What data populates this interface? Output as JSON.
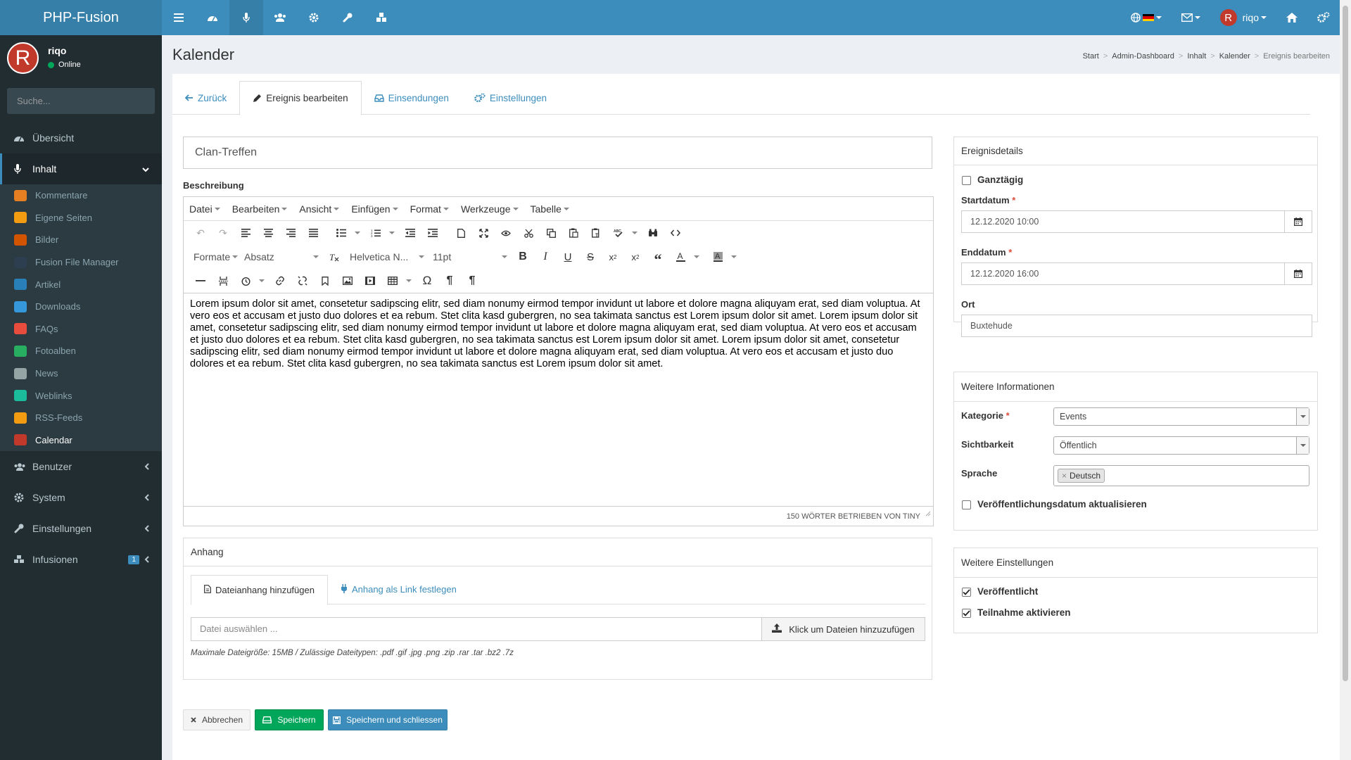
{
  "brand": "PHP-Fusion",
  "topbar": {
    "user_name": "riqo",
    "user_initial": "R"
  },
  "sidebar": {
    "user_name": "riqo",
    "user_initial": "R",
    "status": "Online",
    "search_placeholder": "Suche...",
    "items": {
      "overview": "Übersicht",
      "content": "Inhalt",
      "users": "Benutzer",
      "system": "System",
      "settings": "Einstellungen",
      "infusions": "Infusionen",
      "infusions_badge": "1"
    },
    "subitems": [
      {
        "label": "Kommentare",
        "color": "#e67e22"
      },
      {
        "label": "Eigene Seiten",
        "color": "#f39c12"
      },
      {
        "label": "Bilder",
        "color": "#d35400"
      },
      {
        "label": "Fusion File Manager",
        "color": "#2c3e50"
      },
      {
        "label": "Artikel",
        "color": "#2980b9"
      },
      {
        "label": "Downloads",
        "color": "#3498db"
      },
      {
        "label": "FAQs",
        "color": "#e74c3c"
      },
      {
        "label": "Fotoalben",
        "color": "#27ae60"
      },
      {
        "label": "News",
        "color": "#95a5a6"
      },
      {
        "label": "Weblinks",
        "color": "#1abc9c"
      },
      {
        "label": "RSS-Feeds",
        "color": "#f39c12"
      },
      {
        "label": "Calendar",
        "color": "#c0392b"
      }
    ]
  },
  "page": {
    "title": "Kalender",
    "breadcrumb": [
      "Start",
      "Admin-Dashboard",
      "Inhalt",
      "Kalender",
      "Ereignis bearbeiten"
    ]
  },
  "tabs": {
    "back": "Zurück",
    "edit": "Ereignis bearbeiten",
    "submissions": "Einsendungen",
    "settings": "Einstellungen"
  },
  "form": {
    "title_value": "Clan-Treffen",
    "description_label": "Beschreibung",
    "editor": {
      "menus": [
        "Datei",
        "Bearbeiten",
        "Ansicht",
        "Einfügen",
        "Format",
        "Werkzeuge",
        "Tabelle"
      ],
      "formats_label": "Formate",
      "paragraph_label": "Absatz",
      "font_label": "Helvetica N...",
      "size_label": "11pt",
      "body": "Lorem ipsum dolor sit amet, consetetur sadipscing elitr, sed diam nonumy eirmod tempor invidunt ut labore et dolore magna aliquyam erat, sed diam voluptua. At vero eos et accusam et justo duo dolores et ea rebum. Stet clita kasd gubergren, no sea takimata sanctus est Lorem ipsum dolor sit amet. Lorem ipsum dolor sit amet, consetetur sadipscing elitr, sed diam nonumy eirmod tempor invidunt ut labore et dolore magna aliquyam erat, sed diam voluptua. At vero eos et accusam et justo duo dolores et ea rebum. Stet clita kasd gubergren, no sea takimata sanctus est Lorem ipsum dolor sit amet. Lorem ipsum dolor sit amet, consetetur sadipscing elitr, sed diam nonumy eirmod tempor invidunt ut labore et dolore magna aliquyam erat, sed diam voluptua. At vero eos et accusam et justo duo dolores et ea rebum. Stet clita kasd gubergren, no sea takimata sanctus est Lorem ipsum dolor sit amet.",
      "status": "150 Wörter betrieben von Tiny"
    },
    "attachment": {
      "header": "Anhang",
      "tab_file": "Dateianhang hinzufügen",
      "tab_link": "Anhang als Link festlegen",
      "file_placeholder": "Datei auswählen ...",
      "file_button": "Klick um Dateien hinzuzufügen",
      "hint": "Maximale Dateigröße: 15MB / Zulässige Dateitypen: .pdf .gif .jpg .png .zip .rar .tar .bz2 .7z"
    },
    "buttons": {
      "cancel": "Abbrechen",
      "save": "Speichern",
      "save_close": "Speichern und schliessen"
    }
  },
  "details": {
    "header": "Ereignisdetails",
    "allday": "Ganztägig",
    "start_label": "Startdatum",
    "start_value": "12.12.2020 10:00",
    "end_label": "Enddatum",
    "end_value": "12.12.2020 16:00",
    "location_label": "Ort",
    "location_value": "Buxtehude"
  },
  "more_info": {
    "header": "Weitere Informationen",
    "category_label": "Kategorie",
    "category_value": "Events",
    "visibility_label": "Sichtbarkeit",
    "visibility_value": "Öffentlich",
    "language_label": "Sprache",
    "language_tag": "Deutsch",
    "update_date": "Veröffentlichungsdatum aktualisieren"
  },
  "more_settings": {
    "header": "Weitere Einstellungen",
    "published": "Veröffentlicht",
    "participation": "Teilnahme aktivieren"
  },
  "colors": {
    "primary": "#3c8dbc",
    "sidebar": "#222d32",
    "success": "#00a65a"
  }
}
